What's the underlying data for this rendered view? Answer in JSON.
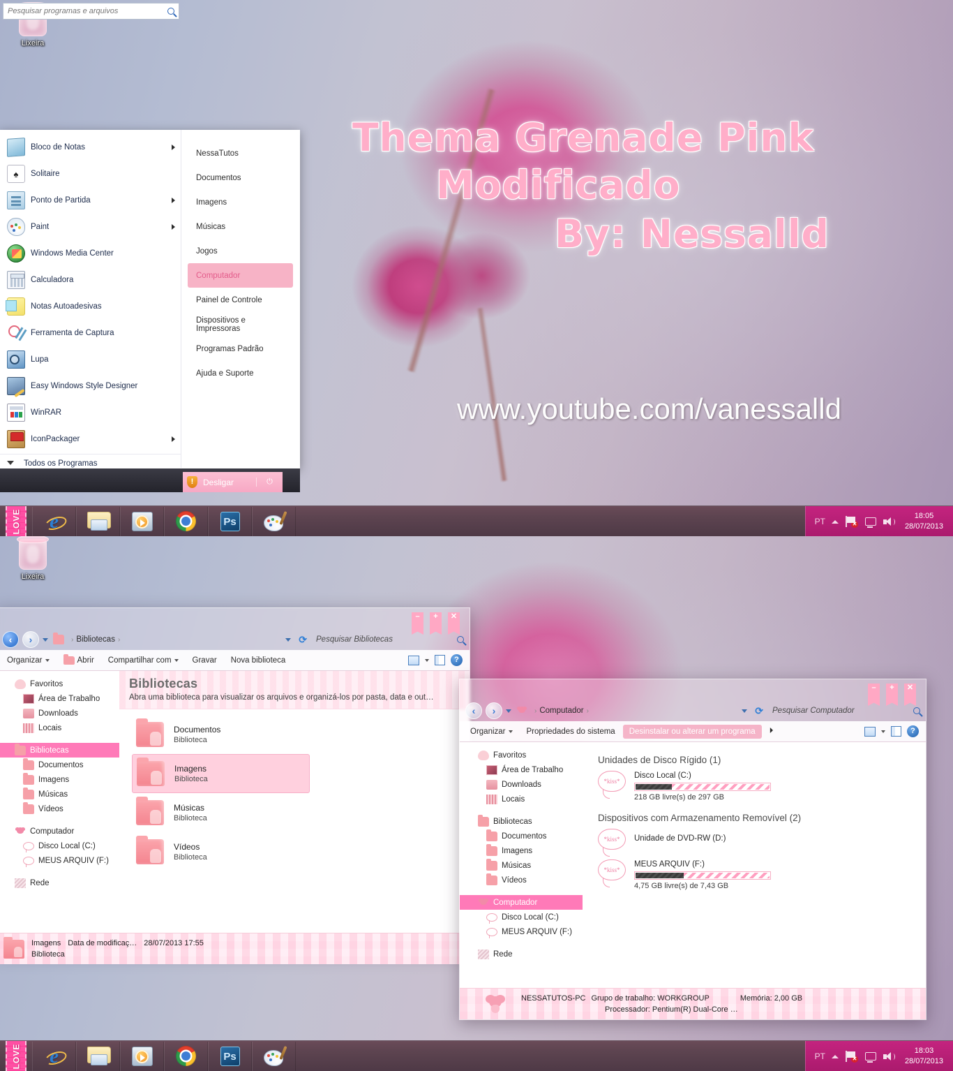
{
  "desktop": {
    "recycle_bin_label": "Lixeira",
    "watermark": {
      "line1": "Thema Grenade Pink",
      "line2": "Modificado",
      "line3": "By: Nessalld",
      "url": "www.youtube.com/vanessalld",
      "color": "#ffaec9"
    }
  },
  "start_menu": {
    "left_items": [
      {
        "label": "Bloco de Notas",
        "icon": "notepad-icon",
        "has_submenu": true
      },
      {
        "label": "Solitaire",
        "icon": "solitaire-icon",
        "has_submenu": false
      },
      {
        "label": "Ponto de Partida",
        "icon": "getting-started-icon",
        "has_submenu": true
      },
      {
        "label": "Paint",
        "icon": "paint-icon",
        "has_submenu": true
      },
      {
        "label": "Windows Media Center",
        "icon": "media-center-icon",
        "has_submenu": false
      },
      {
        "label": "Calculadora",
        "icon": "calculator-icon",
        "has_submenu": false
      },
      {
        "label": "Notas Autoadesivas",
        "icon": "sticky-notes-icon",
        "has_submenu": false
      },
      {
        "label": "Ferramenta de Captura",
        "icon": "snipping-tool-icon",
        "has_submenu": false
      },
      {
        "label": "Lupa",
        "icon": "magnifier-icon",
        "has_submenu": false
      },
      {
        "label": "Easy Windows Style Designer",
        "icon": "style-designer-icon",
        "has_submenu": false
      },
      {
        "label": "WinRAR",
        "icon": "winrar-icon",
        "has_submenu": false
      },
      {
        "label": "IconPackager",
        "icon": "iconpackager-icon",
        "has_submenu": true
      }
    ],
    "all_programs_label": "Todos os Programas",
    "right_items": [
      {
        "label": "NessaTutos",
        "selected": false
      },
      {
        "label": "Documentos",
        "selected": false
      },
      {
        "label": "Imagens",
        "selected": false
      },
      {
        "label": "Músicas",
        "selected": false
      },
      {
        "label": "Jogos",
        "selected": false
      },
      {
        "label": "Computador",
        "selected": true
      },
      {
        "label": "Painel de Controle",
        "selected": false
      },
      {
        "label": "Dispositivos e Impressoras",
        "selected": false
      },
      {
        "label": "Programas Padrão",
        "selected": false
      },
      {
        "label": "Ajuda e Suporte",
        "selected": false
      }
    ],
    "search_placeholder": "Pesquisar programas e arquivos",
    "shutdown_label": "Desligar",
    "accent": "#f7a8c4"
  },
  "taskbar_top": {
    "start_label": "LOVE",
    "apps": [
      {
        "name": "internet-explorer"
      },
      {
        "name": "windows-explorer"
      },
      {
        "name": "windows-media-player"
      },
      {
        "name": "google-chrome"
      },
      {
        "name": "photoshop"
      },
      {
        "name": "paint"
      }
    ],
    "tray": {
      "language": "PT",
      "time": "18:05",
      "date": "28/07/2013"
    }
  },
  "taskbar_bottom": {
    "start_label": "LOVE",
    "tray": {
      "language": "PT",
      "time": "18:03",
      "date": "28/07/2013"
    }
  },
  "libraries_window": {
    "breadcrumb": "Bibliotecas",
    "search_placeholder": "Pesquisar Bibliotecas",
    "window_controls": [
      "minimize",
      "maximize",
      "close"
    ],
    "toolbar": [
      {
        "label": "Organizar",
        "dropdown": true,
        "highlight": false
      },
      {
        "label": "Abrir",
        "dropdown": false,
        "highlight": false
      },
      {
        "label": "Compartilhar com",
        "dropdown": true,
        "highlight": false
      },
      {
        "label": "Gravar",
        "dropdown": false,
        "highlight": false
      },
      {
        "label": "Nova biblioteca",
        "dropdown": false,
        "highlight": false
      }
    ],
    "nav_pane": [
      {
        "label": "Favoritos",
        "type": "group",
        "icon": "favorites-icon",
        "selected": false
      },
      {
        "label": "Área de Trabalho",
        "type": "item",
        "icon": "desktop-icon",
        "selected": false
      },
      {
        "label": "Downloads",
        "type": "item",
        "icon": "downloads-icon",
        "selected": false
      },
      {
        "label": "Locais",
        "type": "item",
        "icon": "places-icon",
        "selected": false
      },
      {
        "label": "Bibliotecas",
        "type": "group",
        "icon": "library-icon",
        "selected": true
      },
      {
        "label": "Documentos",
        "type": "item",
        "icon": "documents-icon",
        "selected": false
      },
      {
        "label": "Imagens",
        "type": "item",
        "icon": "pictures-icon",
        "selected": false
      },
      {
        "label": "Músicas",
        "type": "item",
        "icon": "music-icon",
        "selected": false
      },
      {
        "label": "Vídeos",
        "type": "item",
        "icon": "videos-icon",
        "selected": false
      },
      {
        "label": "Computador",
        "type": "group",
        "icon": "computer-icon",
        "selected": false
      },
      {
        "label": "Disco Local (C:)",
        "type": "item",
        "icon": "drive-icon",
        "selected": false
      },
      {
        "label": "MEUS ARQUIV (F:)",
        "type": "item",
        "icon": "drive-icon",
        "selected": false
      },
      {
        "label": "Rede",
        "type": "group",
        "icon": "network-icon",
        "selected": false
      }
    ],
    "header_title": "Bibliotecas",
    "header_sub": "Abra uma biblioteca para visualizar os arquivos e organizá-los por pasta, data e out…",
    "items": [
      {
        "name": "Documentos",
        "kind": "Biblioteca",
        "selected": false
      },
      {
        "name": "Imagens",
        "kind": "Biblioteca",
        "selected": true
      },
      {
        "name": "Músicas",
        "kind": "Biblioteca",
        "selected": false
      },
      {
        "name": "Vídeos",
        "kind": "Biblioteca",
        "selected": false
      }
    ],
    "status": {
      "name": "Imagens",
      "kind": "Biblioteca",
      "modified_label": "Data de modificaç…",
      "modified_value": "28/07/2013 17:55"
    }
  },
  "computer_window": {
    "breadcrumb": "Computador",
    "search_placeholder": "Pesquisar Computador",
    "toolbar": [
      {
        "label": "Organizar",
        "dropdown": true,
        "highlight": false
      },
      {
        "label": "Propriedades do sistema",
        "dropdown": false,
        "highlight": false
      },
      {
        "label": "Desinstalar ou alterar um programa",
        "dropdown": false,
        "highlight": true
      }
    ],
    "nav_pane": [
      {
        "label": "Favoritos",
        "type": "group",
        "icon": "favorites-icon",
        "selected": false
      },
      {
        "label": "Área de Trabalho",
        "type": "item",
        "icon": "desktop-icon",
        "selected": false
      },
      {
        "label": "Downloads",
        "type": "item",
        "icon": "downloads-icon",
        "selected": false
      },
      {
        "label": "Locais",
        "type": "item",
        "icon": "places-icon",
        "selected": false
      },
      {
        "label": "Bibliotecas",
        "type": "group",
        "icon": "library-icon",
        "selected": false
      },
      {
        "label": "Documentos",
        "type": "item",
        "icon": "documents-icon",
        "selected": false
      },
      {
        "label": "Imagens",
        "type": "item",
        "icon": "pictures-icon",
        "selected": false
      },
      {
        "label": "Músicas",
        "type": "item",
        "icon": "music-icon",
        "selected": false
      },
      {
        "label": "Vídeos",
        "type": "item",
        "icon": "videos-icon",
        "selected": false
      },
      {
        "label": "Computador",
        "type": "group",
        "icon": "computer-icon",
        "selected": true
      },
      {
        "label": "Disco Local (C:)",
        "type": "item",
        "icon": "drive-icon",
        "selected": false
      },
      {
        "label": "MEUS ARQUIV (F:)",
        "type": "item",
        "icon": "drive-icon",
        "selected": false
      },
      {
        "label": "Rede",
        "type": "group",
        "icon": "network-icon",
        "selected": false
      }
    ],
    "group_hdd": "Unidades de Disco Rígido (1)",
    "group_removable": "Dispositivos com Armazenamento Removível (2)",
    "drives": [
      {
        "name": "Disco Local (C:)",
        "capacity_text": "218 GB livre(s) de 297 GB",
        "used_percent": 27,
        "has_bar": true,
        "icon": "kiss-drive-icon"
      },
      {
        "name": "Unidade de DVD-RW (D:)",
        "capacity_text": "",
        "used_percent": 0,
        "has_bar": false,
        "icon": "kiss-drive-icon"
      },
      {
        "name": "MEUS ARQUIV (F:)",
        "capacity_text": "4,75 GB livre(s) de 7,43 GB",
        "used_percent": 36,
        "has_bar": true,
        "icon": "kiss-drive-icon"
      }
    ],
    "status": {
      "pc_name": "NESSATUTOS-PC",
      "workgroup": "Grupo de trabalho: WORKGROUP",
      "memory": "Memória: 2,00 GB",
      "processor": "Processador: Pentium(R) Dual-Core  …"
    }
  }
}
